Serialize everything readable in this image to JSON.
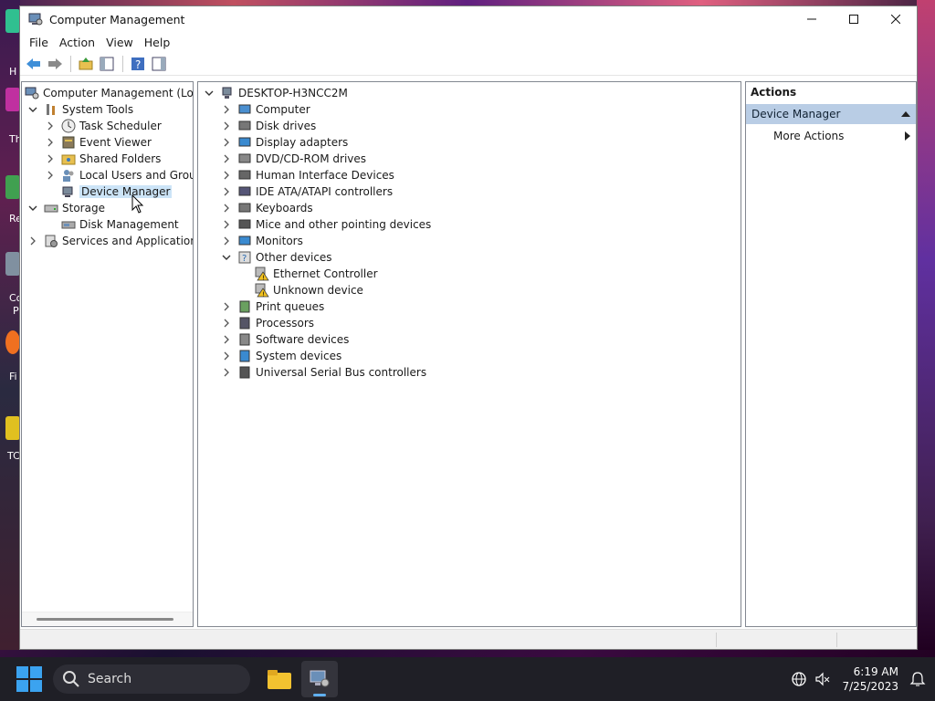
{
  "window": {
    "title": "Computer Management",
    "controls": {
      "minimize": "—",
      "maximize": "☐",
      "close": "✕"
    }
  },
  "menubar": [
    "File",
    "Action",
    "View",
    "Help"
  ],
  "left_tree": {
    "root": "Computer Management (Local",
    "system_tools": "System Tools",
    "task_scheduler": "Task Scheduler",
    "event_viewer": "Event Viewer",
    "shared_folders": "Shared Folders",
    "local_users": "Local Users and Groups",
    "device_manager": "Device Manager",
    "storage": "Storage",
    "disk_management": "Disk Management",
    "services": "Services and Applications"
  },
  "device_tree": {
    "root": "DESKTOP-H3NCC2M",
    "items": [
      "Computer",
      "Disk drives",
      "Display adapters",
      "DVD/CD-ROM drives",
      "Human Interface Devices",
      "IDE ATA/ATAPI controllers",
      "Keyboards",
      "Mice and other pointing devices",
      "Monitors",
      "Other devices"
    ],
    "other_children": [
      "Ethernet Controller",
      "Unknown device"
    ],
    "items_after": [
      "Print queues",
      "Processors",
      "Software devices",
      "System devices",
      "Universal Serial Bus controllers"
    ]
  },
  "actions": {
    "header": "Actions",
    "section": "Device Manager",
    "more": "More Actions"
  },
  "taskbar": {
    "search_placeholder": "Search",
    "time": "6:19 AM",
    "date": "7/25/2023"
  },
  "desktop_labels": [
    "H",
    "Th",
    "Re",
    "Co",
    "P",
    "Fi",
    "TC"
  ],
  "colors": {
    "selection": "#cce4f7",
    "action_section": "#b9cde5",
    "accent": "#3ba3f0"
  }
}
